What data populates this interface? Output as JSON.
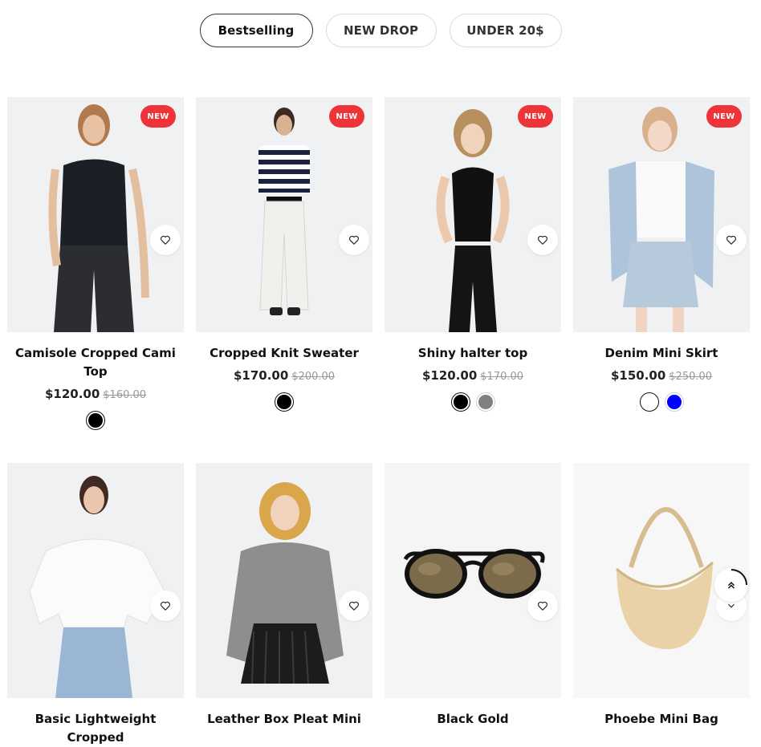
{
  "tabs": [
    {
      "label": "Bestselling"
    },
    {
      "label": "NEW DROP"
    },
    {
      "label": "UNDER 20$"
    }
  ],
  "products": [
    {
      "badge": "NEW",
      "name": "Camisole Cropped Cami Top",
      "price": "$120.00",
      "old_price": "$160.00",
      "swatches": [
        "#000000"
      ]
    },
    {
      "badge": "NEW",
      "name": "Cropped Knit Sweater",
      "price": "$170.00",
      "old_price": "$200.00",
      "swatches": [
        "#000000"
      ]
    },
    {
      "badge": "NEW",
      "name": "Shiny halter top",
      "price": "$120.00",
      "old_price": "$170.00",
      "swatches": [
        "#000000",
        "#808080"
      ]
    },
    {
      "badge": "NEW",
      "name": "Denim Mini Skirt",
      "price": "$150.00",
      "old_price": "$250.00",
      "swatches": [
        "#ffffff",
        "#0000ff"
      ]
    },
    {
      "name": "Basic Lightweight Cropped"
    },
    {
      "name": "Leather Box Pleat Mini"
    },
    {
      "name": "Black Gold"
    },
    {
      "name": "Phoebe Mini Bag"
    }
  ],
  "icons": {
    "wishlist": "heart-icon",
    "scroll_top": "double-chevron-up-icon",
    "scroll_down": "chevron-down-icon"
  }
}
